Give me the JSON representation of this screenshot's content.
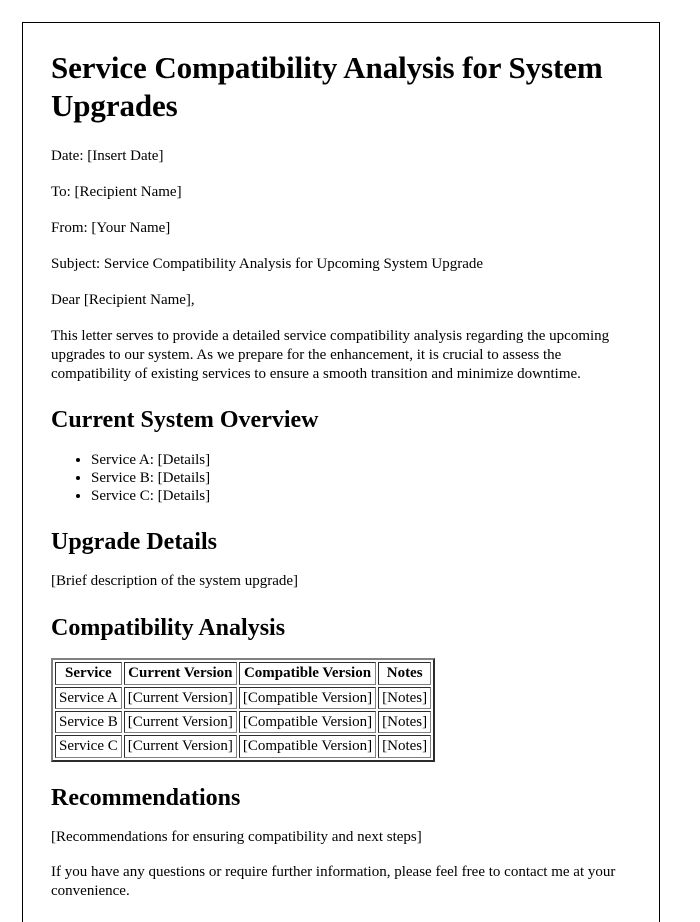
{
  "document": {
    "title": "Service Compatibility Analysis for System Upgrades",
    "meta": {
      "date": "Date: [Insert Date]",
      "to": "To: [Recipient Name]",
      "from": "From: [Your Name]",
      "subject": "Subject: Service Compatibility Analysis for Upcoming System Upgrade",
      "salutation": "Dear [Recipient Name],"
    },
    "intro_paragraph": "This letter serves to provide a detailed service compatibility analysis regarding the upcoming upgrades to our system. As we prepare for the enhancement, it is crucial to assess the compatibility of existing services to ensure a smooth transition and minimize downtime.",
    "sections": {
      "current_system_overview": {
        "heading": "Current System Overview",
        "items": [
          "Service A: [Details]",
          "Service B: [Details]",
          "Service C: [Details]"
        ]
      },
      "upgrade_details": {
        "heading": "Upgrade Details",
        "body": "[Brief description of the system upgrade]"
      },
      "compatibility_analysis": {
        "heading": "Compatibility Analysis",
        "table": {
          "columns": [
            "Service",
            "Current Version",
            "Compatible Version",
            "Notes"
          ],
          "rows": [
            [
              "Service A",
              "[Current Version]",
              "[Compatible Version]",
              "[Notes]"
            ],
            [
              "Service B",
              "[Current Version]",
              "[Compatible Version]",
              "[Notes]"
            ],
            [
              "Service C",
              "[Current Version]",
              "[Compatible Version]",
              "[Notes]"
            ]
          ]
        }
      },
      "recommendations": {
        "heading": "Recommendations",
        "body": "[Recommendations for ensuring compatibility and next steps]"
      }
    },
    "closing_paragraph": "If you have any questions or require further information, please feel free to contact me at your convenience."
  }
}
